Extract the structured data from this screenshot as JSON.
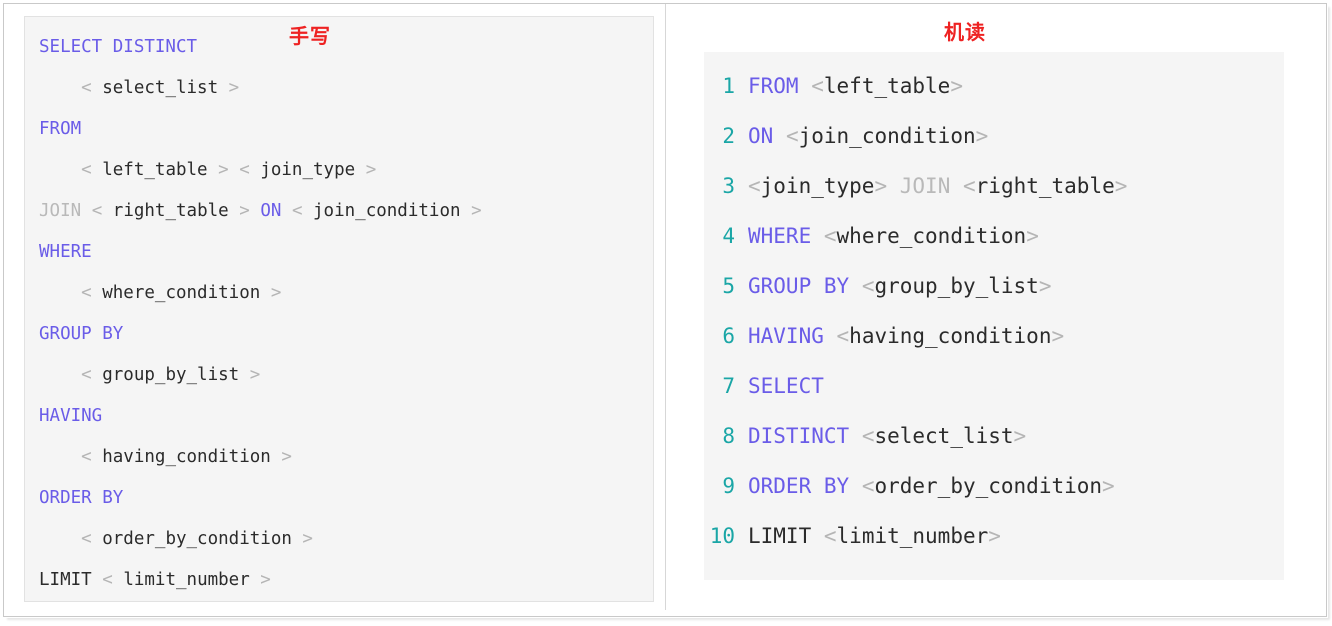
{
  "labels": {
    "handwritten": "手写",
    "machine_read": "机读"
  },
  "colors": {
    "keyword": "#6a5ce8",
    "keyword_dim": "#b9b9b9",
    "placeholder": "#2b2b2b",
    "angle_bracket": "#b5b5b5",
    "line_number": "#1aa6a6",
    "annotation_red": "#ee2222",
    "code_background": "#f5f5f5",
    "page_background": "#ffffff"
  },
  "left_panel": {
    "title": "手写",
    "lines": [
      {
        "indent": false,
        "tokens": [
          {
            "t": "SELECT DISTINCT",
            "c": "kw"
          }
        ]
      },
      {
        "indent": true,
        "tokens": [
          {
            "t": "<",
            "c": "ang"
          },
          {
            "t": " select_list ",
            "c": "ph"
          },
          {
            "t": ">",
            "c": "ang"
          }
        ]
      },
      {
        "indent": false,
        "tokens": [
          {
            "t": "FROM",
            "c": "kw"
          }
        ]
      },
      {
        "indent": true,
        "tokens": [
          {
            "t": "<",
            "c": "ang"
          },
          {
            "t": " left_table ",
            "c": "ph"
          },
          {
            "t": ">",
            "c": "ang"
          },
          {
            "t": " ",
            "c": "ph"
          },
          {
            "t": "<",
            "c": "ang"
          },
          {
            "t": " join_type ",
            "c": "ph"
          },
          {
            "t": ">",
            "c": "ang"
          }
        ]
      },
      {
        "indent": false,
        "tokens": [
          {
            "t": "JOIN",
            "c": "kw-dim"
          },
          {
            "t": " ",
            "c": "ph"
          },
          {
            "t": "<",
            "c": "ang"
          },
          {
            "t": " right_table ",
            "c": "ph"
          },
          {
            "t": ">",
            "c": "ang"
          },
          {
            "t": " ",
            "c": "ph"
          },
          {
            "t": "ON",
            "c": "kw"
          },
          {
            "t": " ",
            "c": "ph"
          },
          {
            "t": "<",
            "c": "ang"
          },
          {
            "t": " join_condition ",
            "c": "ph"
          },
          {
            "t": ">",
            "c": "ang"
          }
        ]
      },
      {
        "indent": false,
        "tokens": [
          {
            "t": "WHERE",
            "c": "kw"
          }
        ]
      },
      {
        "indent": true,
        "tokens": [
          {
            "t": "<",
            "c": "ang"
          },
          {
            "t": " where_condition ",
            "c": "ph"
          },
          {
            "t": ">",
            "c": "ang"
          }
        ]
      },
      {
        "indent": false,
        "tokens": [
          {
            "t": "GROUP BY",
            "c": "kw"
          }
        ]
      },
      {
        "indent": true,
        "tokens": [
          {
            "t": "<",
            "c": "ang"
          },
          {
            "t": " group_by_list ",
            "c": "ph"
          },
          {
            "t": ">",
            "c": "ang"
          }
        ]
      },
      {
        "indent": false,
        "tokens": [
          {
            "t": "HAVING",
            "c": "kw"
          }
        ]
      },
      {
        "indent": true,
        "tokens": [
          {
            "t": "<",
            "c": "ang"
          },
          {
            "t": " having_condition ",
            "c": "ph"
          },
          {
            "t": ">",
            "c": "ang"
          }
        ]
      },
      {
        "indent": false,
        "tokens": [
          {
            "t": "ORDER BY",
            "c": "kw"
          }
        ]
      },
      {
        "indent": true,
        "tokens": [
          {
            "t": "<",
            "c": "ang"
          },
          {
            "t": " order_by_condition ",
            "c": "ph"
          },
          {
            "t": ">",
            "c": "ang"
          }
        ]
      },
      {
        "indent": false,
        "tokens": [
          {
            "t": "LIMIT",
            "c": "ph"
          },
          {
            "t": " ",
            "c": "ph"
          },
          {
            "t": "<",
            "c": "ang"
          },
          {
            "t": " limit_number ",
            "c": "ph"
          },
          {
            "t": ">",
            "c": "ang"
          }
        ]
      }
    ],
    "plain_text": "SELECT DISTINCT\n    < select_list >\nFROM\n    < left_table > < join_type >\nJOIN < right_table > ON < join_condition >\nWHERE\n    < where_condition >\nGROUP BY\n    < group_by_list >\nHAVING\n    < having_condition >\nORDER BY\n    < order_by_condition >\nLIMIT < limit_number >"
  },
  "right_panel": {
    "title": "机读",
    "lines": [
      {
        "num": "1",
        "tokens": [
          {
            "t": "FROM",
            "c": "kw"
          },
          {
            "t": " ",
            "c": "ph"
          },
          {
            "t": "<",
            "c": "ang"
          },
          {
            "t": "left_table",
            "c": "ph"
          },
          {
            "t": ">",
            "c": "ang"
          }
        ]
      },
      {
        "num": "2",
        "tokens": [
          {
            "t": "ON",
            "c": "kw"
          },
          {
            "t": " ",
            "c": "ph"
          },
          {
            "t": "<",
            "c": "ang"
          },
          {
            "t": "join_condition",
            "c": "ph"
          },
          {
            "t": ">",
            "c": "ang"
          }
        ]
      },
      {
        "num": "3",
        "tokens": [
          {
            "t": "<",
            "c": "ang"
          },
          {
            "t": "join_type",
            "c": "ph"
          },
          {
            "t": ">",
            "c": "ang"
          },
          {
            "t": " ",
            "c": "ph"
          },
          {
            "t": "JOIN",
            "c": "kw-dim"
          },
          {
            "t": " ",
            "c": "ph"
          },
          {
            "t": "<",
            "c": "ang"
          },
          {
            "t": "right_table",
            "c": "ph"
          },
          {
            "t": ">",
            "c": "ang"
          }
        ]
      },
      {
        "num": "4",
        "tokens": [
          {
            "t": "WHERE",
            "c": "kw"
          },
          {
            "t": " ",
            "c": "ph"
          },
          {
            "t": "<",
            "c": "ang"
          },
          {
            "t": "where_condition",
            "c": "ph"
          },
          {
            "t": ">",
            "c": "ang"
          }
        ]
      },
      {
        "num": "5",
        "tokens": [
          {
            "t": "GROUP BY",
            "c": "kw"
          },
          {
            "t": " ",
            "c": "ph"
          },
          {
            "t": "<",
            "c": "ang"
          },
          {
            "t": "group_by_list",
            "c": "ph"
          },
          {
            "t": ">",
            "c": "ang"
          }
        ]
      },
      {
        "num": "6",
        "tokens": [
          {
            "t": "HAVING",
            "c": "kw"
          },
          {
            "t": " ",
            "c": "ph"
          },
          {
            "t": "<",
            "c": "ang"
          },
          {
            "t": "having_condition",
            "c": "ph"
          },
          {
            "t": ">",
            "c": "ang"
          }
        ]
      },
      {
        "num": "7",
        "tokens": [
          {
            "t": "SELECT",
            "c": "kw"
          }
        ]
      },
      {
        "num": "8",
        "tokens": [
          {
            "t": "DISTINCT",
            "c": "kw"
          },
          {
            "t": " ",
            "c": "ph"
          },
          {
            "t": "<",
            "c": "ang"
          },
          {
            "t": "select_list",
            "c": "ph"
          },
          {
            "t": ">",
            "c": "ang"
          }
        ]
      },
      {
        "num": "9",
        "tokens": [
          {
            "t": "ORDER BY",
            "c": "kw"
          },
          {
            "t": " ",
            "c": "ph"
          },
          {
            "t": "<",
            "c": "ang"
          },
          {
            "t": "order_by_condition",
            "c": "ph"
          },
          {
            "t": ">",
            "c": "ang"
          }
        ]
      },
      {
        "num": "10",
        "tokens": [
          {
            "t": "LIMIT",
            "c": "ph"
          },
          {
            "t": " ",
            "c": "ph"
          },
          {
            "t": "<",
            "c": "ang"
          },
          {
            "t": "limit_number",
            "c": "ph"
          },
          {
            "t": ">",
            "c": "ang"
          }
        ]
      }
    ],
    "plain_text": "1 FROM <left_table>\n2 ON <join_condition>\n3 <join_type> JOIN <right_table>\n4 WHERE <where_condition>\n5 GROUP BY <group_by_list>\n6 HAVING <having_condition>\n7 SELECT\n8 DISTINCT <select_list>\n9 ORDER BY <order_by_condition>\n10 LIMIT <limit_number>"
  }
}
